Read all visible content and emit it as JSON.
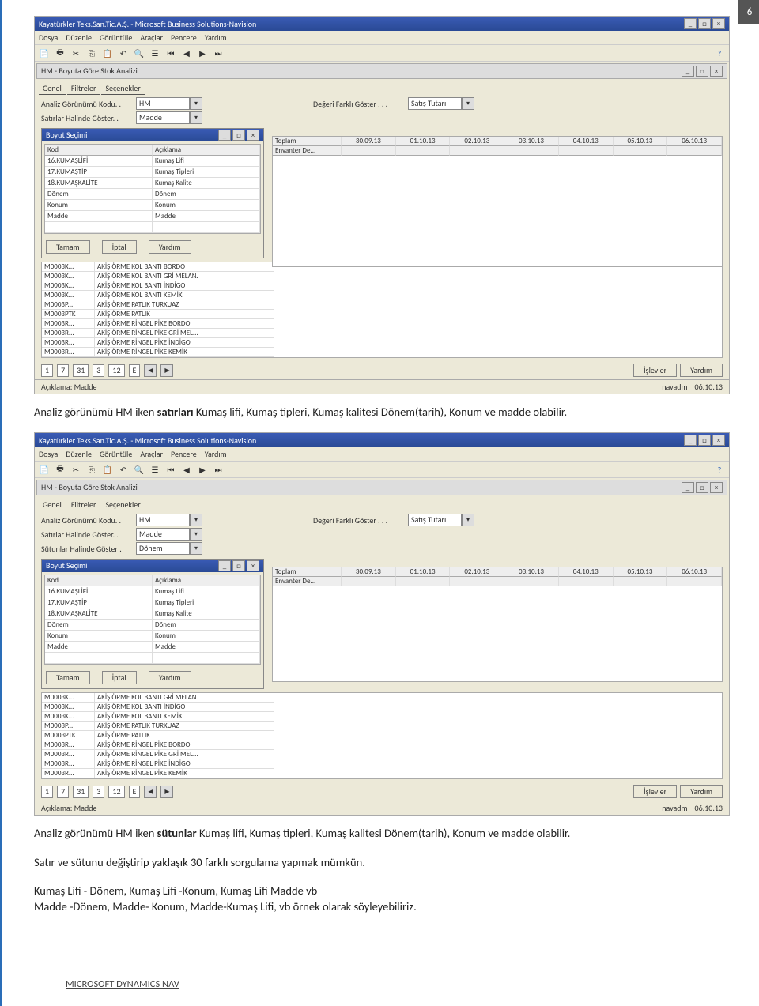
{
  "page_number": "6",
  "app_title": "Kayatürkler Teks.San.Tic.A.Ş.  -  Microsoft Business Solutions-Navision",
  "menus": [
    "Dosya",
    "Düzenle",
    "Görüntüle",
    "Araçlar",
    "Pencere",
    "Yardım"
  ],
  "subwindow_title": "HM - Boyuta Göre Stok Analizi",
  "tabs": [
    "Genel",
    "Filtreler",
    "Seçenekler"
  ],
  "form": {
    "analiz_label": "Analiz Görünümü Kodu. .",
    "analiz_value": "HM",
    "degeri_label": "Değeri Farklı Göster  .  .  .",
    "degeri_value": "Satış Tutarı",
    "satir_label": "Satırlar Halinde Göster. .",
    "satir_value": "Madde",
    "sutun_label": "Sütunlar Halinde Göster .",
    "sutun_value": "Dönem"
  },
  "popup_title": "Boyut Seçimi",
  "popup_cols": [
    "Kod",
    "Açıklama"
  ],
  "popup_rows": [
    {
      "k": "16.KUMAŞLİFİ",
      "a": "Kumaş Lifi"
    },
    {
      "k": "17.KUMAŞTİP",
      "a": "Kumaş Tipleri"
    },
    {
      "k": "18.KUMAŞKALİTE",
      "a": "Kumaş Kalite"
    },
    {
      "k": "Dönem",
      "a": "Dönem"
    },
    {
      "k": "Konum",
      "a": "Konum"
    },
    {
      "k": "Madde",
      "a": "Madde"
    }
  ],
  "popup_buttons": {
    "ok": "Tamam",
    "cancel": "İptal",
    "help": "Yardım"
  },
  "date_headers": {
    "h1": "Toplam",
    "h2": "Envanter De..."
  },
  "dates": [
    "30.09.13",
    "01.10.13",
    "02.10.13",
    "03.10.13",
    "04.10.13",
    "05.10.13",
    "06.10.13"
  ],
  "list_rows_1": [
    {
      "c": "M0003K...",
      "d": "AKİŞ ÖRME KOL BANTI BORDO"
    },
    {
      "c": "M0003K...",
      "d": "AKİŞ ÖRME KOL BANTI GRİ MELANJ"
    },
    {
      "c": "M0003K...",
      "d": "AKİŞ ÖRME KOL BANTI İNDİGO"
    },
    {
      "c": "M0003K...",
      "d": "AKİŞ ÖRME KOL BANTI KEMİK"
    },
    {
      "c": "M0003P...",
      "d": "AKİŞ ÖRME PATLIK TURKUAZ"
    },
    {
      "c": "M0003PTK",
      "d": "AKİŞ ÖRME PATLIK"
    },
    {
      "c": "M0003R...",
      "d": "AKİŞ ÖRME RİNGEL PİKE BORDO"
    },
    {
      "c": "M0003R...",
      "d": "AKİŞ ÖRME RİNGEL PİKE GRİ MEL..."
    },
    {
      "c": "M0003R...",
      "d": "AKİŞ ÖRME RİNGEL PİKE İNDİGO"
    },
    {
      "c": "M0003R...",
      "d": "AKİŞ ÖRME RİNGEL PİKE KEMİK"
    }
  ],
  "list_rows_2": [
    {
      "c": "M0003K...",
      "d": "AKİŞ ÖRME KOL BANTI GRİ MELANJ"
    },
    {
      "c": "M0003K...",
      "d": "AKİŞ ÖRME KOL BANTI İNDİGO"
    },
    {
      "c": "M0003K...",
      "d": "AKİŞ ÖRME KOL BANTI KEMİK"
    },
    {
      "c": "M0003P...",
      "d": "AKİŞ ÖRME PATLIK TURKUAZ"
    },
    {
      "c": "M0003PTK",
      "d": "AKİŞ ÖRME PATLIK"
    },
    {
      "c": "M0003R...",
      "d": "AKİŞ ÖRME RİNGEL PİKE BORDO"
    },
    {
      "c": "M0003R...",
      "d": "AKİŞ ÖRME RİNGEL PİKE GRİ MEL..."
    },
    {
      "c": "M0003R...",
      "d": "AKİŞ ÖRME RİNGEL PİKE İNDİGO"
    },
    {
      "c": "M0003R...",
      "d": "AKİŞ ÖRME RİNGEL PİKE KEMİK"
    }
  ],
  "pager": {
    "v1": "1",
    "v2": "7",
    "v3": "31",
    "v4": "3",
    "v5": "12",
    "v6": "E"
  },
  "pager_buttons": {
    "islev": "İşlevler",
    "help": "Yardım"
  },
  "status_label": "Açıklama: Madde",
  "status_user": "navadm",
  "status_date": "06.10.13",
  "paragraph1_a": "Analiz görünümü HM iken ",
  "paragraph1_b": "satırları",
  "paragraph1_c": " Kumaş lifi, Kumaş tipleri, Kumaş kalitesi Dönem(tarih), Konum ve madde olabilir.",
  "paragraph2_a": "Analiz görünümü HM iken ",
  "paragraph2_b": "sütunlar",
  "paragraph2_c": " Kumaş lifi, Kumaş tipleri, Kumaş kalitesi Dönem(tarih), Konum ve madde olabilir.",
  "paragraph3": "Satır ve sütunu değiştirip yaklaşık 30 farklı sorgulama yapmak mümkün.",
  "paragraph4": "Kumaş Lifi - Dönem, Kumaş Lifi -Konum, Kumaş Lifi Madde vb",
  "paragraph5": "Madde -Dönem, Madde- Konum, Madde-Kumaş Lifi,  vb örnek olarak söyleyebiliriz.",
  "footer": "MICROSOFT DYNAMICS NAV"
}
